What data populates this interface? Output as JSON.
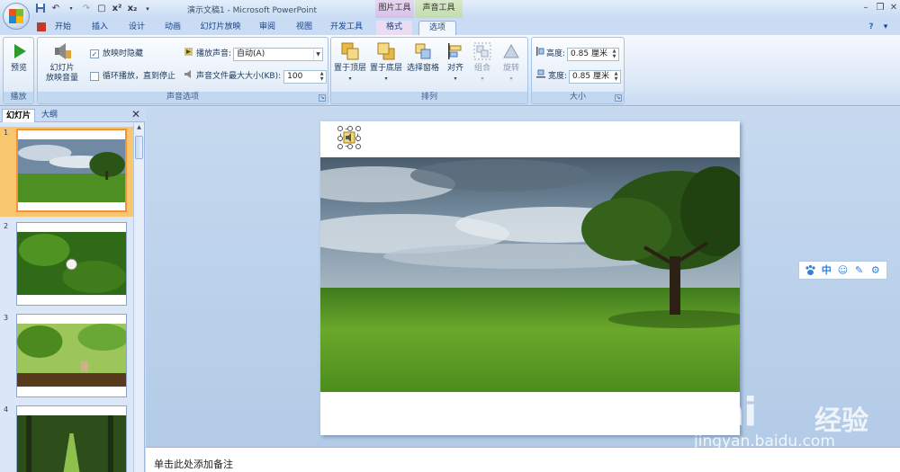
{
  "window": {
    "title": "演示文稿1 - Microsoft PowerPoint",
    "context_groups": [
      "图片工具",
      "声音工具"
    ]
  },
  "tabs": [
    "开始",
    "插入",
    "设计",
    "动画",
    "幻灯片放映",
    "审阅",
    "视图",
    "开发工具",
    "格式",
    "选项"
  ],
  "active_tab": "选项",
  "ribbon": {
    "preview": {
      "label": "预览",
      "group": "播放"
    },
    "volume": {
      "label_line1": "幻灯片",
      "label_line2": "放映音量"
    },
    "hide_during_show": {
      "label": "放映时隐藏",
      "checked": true
    },
    "loop": {
      "label": "循环播放，直到停止",
      "checked": false
    },
    "play_sound": {
      "label": "播放声音:",
      "value": "自动(A)"
    },
    "max_size": {
      "label": "声音文件最大大小(KB):",
      "value": "100"
    },
    "sound_options_group": "声音选项",
    "arrange": {
      "bring_front": "置于顶层",
      "send_back": "置于底层",
      "selection_pane": "选择窗格",
      "align": "对齐",
      "group": "组合",
      "rotate": "旋转",
      "group_label": "排列"
    },
    "size": {
      "height_label": "高度:",
      "height_value": "0.85 厘米",
      "width_label": "宽度:",
      "width_value": "0.85 厘米",
      "group_label": "大小"
    }
  },
  "left_pane": {
    "tabs": [
      "幻灯片",
      "大纲"
    ],
    "slides": [
      {
        "num": "1",
        "selected": true
      },
      {
        "num": "2",
        "selected": false
      },
      {
        "num": "3",
        "selected": false
      },
      {
        "num": "4",
        "selected": false
      }
    ]
  },
  "notes": {
    "placeholder": "单击此处添加备注"
  },
  "ime_bar": [
    "paw-icon",
    "中",
    "smile-icon",
    "pen-icon",
    "gear-icon"
  ],
  "watermark": {
    "brand": "Bai",
    "brand_cn": "经验",
    "url": "jingyan.baidu.com"
  },
  "colors": {
    "ribbon_bg": "#dbe7f7",
    "selected_thumb": "#f9c670",
    "accent": "#2e7fe0"
  }
}
